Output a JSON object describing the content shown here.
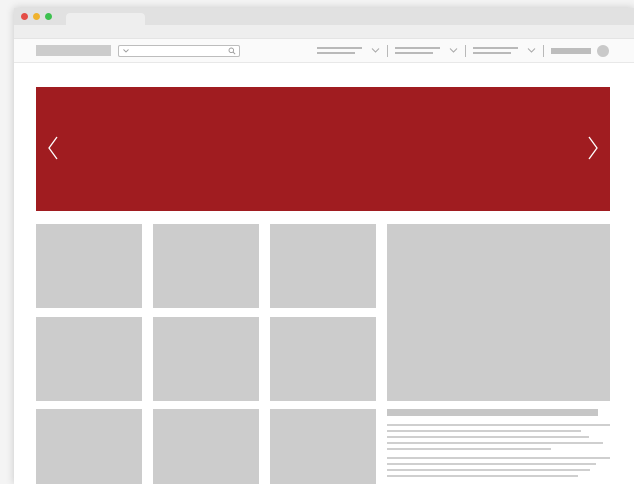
{
  "browser": {
    "buttons": [
      "close",
      "minimize",
      "maximize"
    ],
    "icons": {
      "window_close": "red-dot",
      "window_minimize": "yellow-dot",
      "window_maximize": "green-dot"
    }
  },
  "header": {
    "icons": {
      "search_dropdown": "chevron-down-icon",
      "search": "search-icon",
      "nav_dropdown": "chevron-down-icon",
      "avatar": "avatar"
    }
  },
  "hero": {
    "background_color": "#a01c20",
    "icons": {
      "prev": "chevron-left-icon",
      "next": "chevron-right-icon"
    }
  },
  "colors": {
    "placeholder": "#cccccc",
    "chrome": "#e1e1e1",
    "accent": "#a01c20"
  }
}
